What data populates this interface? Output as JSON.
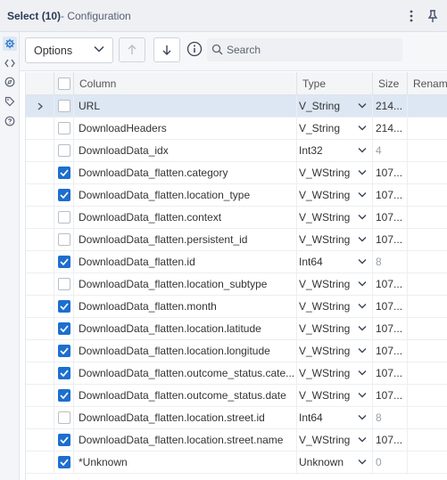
{
  "window": {
    "title": "Select (10)",
    "subtitle": "- Configuration"
  },
  "left_rail": [
    "gear-icon",
    "code-icon",
    "annotation-icon",
    "tag-icon",
    "help-icon"
  ],
  "toolbar": {
    "options_label": "Options",
    "search_placeholder": "Search",
    "search_value": ""
  },
  "grid": {
    "columns": [
      "Column",
      "Type",
      "Size",
      "Rename"
    ],
    "rows": [
      {
        "checked": false,
        "column": "URL",
        "type": "V_String",
        "size": "214...",
        "size_muted": false,
        "selected": true,
        "expandable": true
      },
      {
        "checked": false,
        "column": "DownloadHeaders",
        "type": "V_String",
        "size": "214...",
        "size_muted": false,
        "selected": false,
        "expandable": false
      },
      {
        "checked": false,
        "column": "DownloadData_idx",
        "type": "Int32",
        "size": "4",
        "size_muted": true,
        "selected": false,
        "expandable": false
      },
      {
        "checked": true,
        "column": "DownloadData_flatten.category",
        "type": "V_WString",
        "size": "107...",
        "size_muted": false,
        "selected": false,
        "expandable": false
      },
      {
        "checked": true,
        "column": "DownloadData_flatten.location_type",
        "type": "V_WString",
        "size": "107...",
        "size_muted": false,
        "selected": false,
        "expandable": false
      },
      {
        "checked": false,
        "column": "DownloadData_flatten.context",
        "type": "V_WString",
        "size": "107...",
        "size_muted": false,
        "selected": false,
        "expandable": false
      },
      {
        "checked": false,
        "column": "DownloadData_flatten.persistent_id",
        "type": "V_WString",
        "size": "107...",
        "size_muted": false,
        "selected": false,
        "expandable": false
      },
      {
        "checked": true,
        "column": "DownloadData_flatten.id",
        "type": "Int64",
        "size": "8",
        "size_muted": true,
        "selected": false,
        "expandable": false
      },
      {
        "checked": false,
        "column": "DownloadData_flatten.location_subtype",
        "type": "V_WString",
        "size": "107...",
        "size_muted": false,
        "selected": false,
        "expandable": false
      },
      {
        "checked": true,
        "column": "DownloadData_flatten.month",
        "type": "V_WString",
        "size": "107...",
        "size_muted": false,
        "selected": false,
        "expandable": false
      },
      {
        "checked": true,
        "column": "DownloadData_flatten.location.latitude",
        "type": "V_WString",
        "size": "107...",
        "size_muted": false,
        "selected": false,
        "expandable": false
      },
      {
        "checked": true,
        "column": "DownloadData_flatten.location.longitude",
        "type": "V_WString",
        "size": "107...",
        "size_muted": false,
        "selected": false,
        "expandable": false
      },
      {
        "checked": true,
        "column": "DownloadData_flatten.outcome_status.cate...",
        "type": "V_WString",
        "size": "107...",
        "size_muted": false,
        "selected": false,
        "expandable": false
      },
      {
        "checked": true,
        "column": "DownloadData_flatten.outcome_status.date",
        "type": "V_WString",
        "size": "107...",
        "size_muted": false,
        "selected": false,
        "expandable": false
      },
      {
        "checked": false,
        "column": "DownloadData_flatten.location.street.id",
        "type": "Int64",
        "size": "8",
        "size_muted": true,
        "selected": false,
        "expandable": false
      },
      {
        "checked": true,
        "column": "DownloadData_flatten.location.street.name",
        "type": "V_WString",
        "size": "107...",
        "size_muted": false,
        "selected": false,
        "expandable": false
      },
      {
        "checked": true,
        "column": "*Unknown",
        "type": "Unknown",
        "size": "0",
        "size_muted": true,
        "selected": false,
        "expandable": false
      }
    ]
  },
  "colors": {
    "accent": "#1d6fcf",
    "selected_row": "#dde7f3",
    "title_text": "#2b3a55"
  }
}
